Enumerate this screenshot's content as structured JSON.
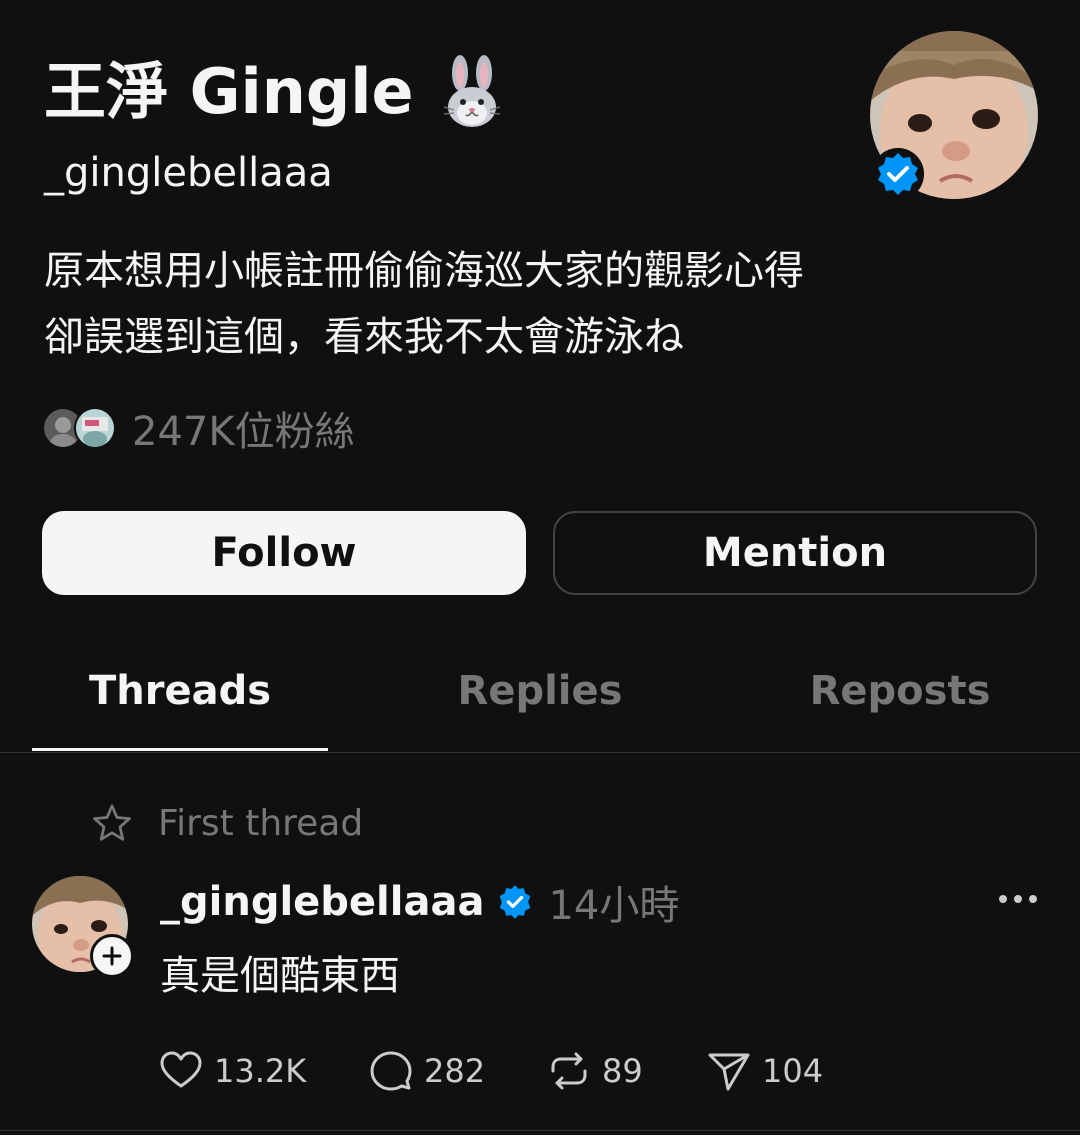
{
  "profile": {
    "display_name": "王淨 Gingle",
    "name_emoji": "rabbit-face-emoji",
    "username": "_ginglebellaaa",
    "verified": true,
    "bio_lines": [
      "原本想用小帳註冊偷偷海巡大家的觀影心得",
      "卻誤選到這個，看來我不太會游泳ね"
    ],
    "followers_label": "247K位粉絲"
  },
  "buttons": {
    "follow": "Follow",
    "mention": "Mention"
  },
  "tabs": [
    {
      "label": "Threads",
      "active": true
    },
    {
      "label": "Replies",
      "active": false
    },
    {
      "label": "Reposts",
      "active": false
    }
  ],
  "post": {
    "pinned_label": "First thread",
    "username": "_ginglebellaaa",
    "time": "14小時",
    "text": "真是個酷東西",
    "likes": "13.2K",
    "replies": "282",
    "reposts": "89",
    "shares": "104"
  },
  "colors": {
    "background": "#101010",
    "text": "#f3f5f7",
    "muted": "#777777",
    "verified_blue": "#0095f6"
  }
}
